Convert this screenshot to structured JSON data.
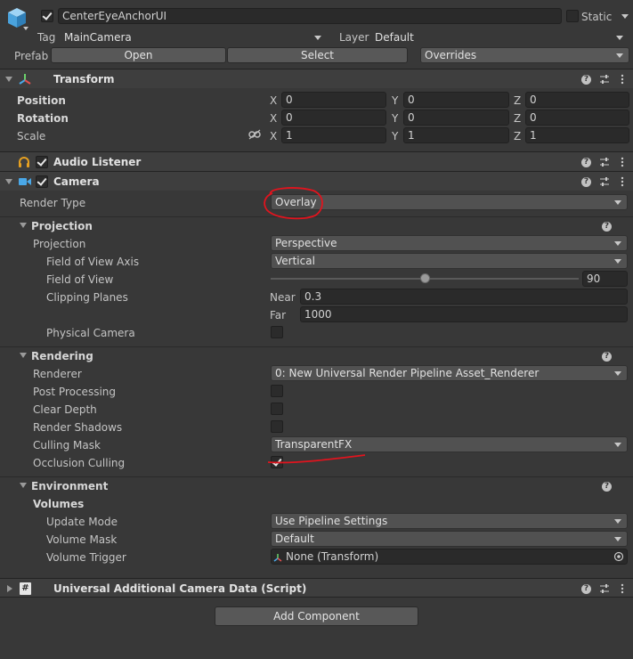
{
  "header": {
    "object_name": "CenterEyeAnchorUI",
    "active": true,
    "static_label": "Static",
    "tag_label": "Tag",
    "tag_value": "MainCamera",
    "layer_label": "Layer",
    "layer_value": "Default",
    "prefab_label": "Prefab",
    "open_label": "Open",
    "select_label": "Select",
    "overrides_label": "Overrides"
  },
  "transform": {
    "title": "Transform",
    "position_label": "Position",
    "rotation_label": "Rotation",
    "scale_label": "Scale",
    "x": "X",
    "y": "Y",
    "z": "Z",
    "position": [
      "0",
      "0",
      "0"
    ],
    "rotation": [
      "0",
      "0",
      "0"
    ],
    "scale": [
      "1",
      "1",
      "1"
    ]
  },
  "audio": {
    "title": "Audio Listener",
    "enabled": true
  },
  "camera": {
    "title": "Camera",
    "enabled": true,
    "render_type_label": "Render Type",
    "render_type_value": "Overlay",
    "projection_section": "Projection",
    "projection_label": "Projection",
    "projection_value": "Perspective",
    "fov_axis_label": "Field of View Axis",
    "fov_axis_value": "Vertical",
    "fov_label": "Field of View",
    "fov_value": "90",
    "fov_level": 0.5,
    "clipping_label": "Clipping Planes",
    "near_label": "Near",
    "near_value": "0.3",
    "far_label": "Far",
    "far_value": "1000",
    "physical_label": "Physical Camera",
    "rendering_section": "Rendering",
    "renderer_label": "Renderer",
    "renderer_value": "0: New Universal Render Pipeline Asset_Renderer",
    "post_processing_label": "Post Processing",
    "clear_depth_label": "Clear Depth",
    "render_shadows_label": "Render Shadows",
    "culling_mask_label": "Culling Mask",
    "culling_mask_value": "TransparentFX",
    "occlusion_label": "Occlusion Culling",
    "environment_section": "Environment",
    "volumes_label": "Volumes",
    "update_mode_label": "Update Mode",
    "update_mode_value": "Use Pipeline Settings",
    "volume_mask_label": "Volume Mask",
    "volume_mask_value": "Default",
    "volume_trigger_label": "Volume Trigger",
    "volume_trigger_value": "None (Transform)"
  },
  "additional": {
    "title": "Universal Additional Camera Data (Script)"
  },
  "add_component_label": "Add Component",
  "colors": {
    "annotation": "#e0141e",
    "camera_icon": "#4aa8e8",
    "audio_icon": "#e6a021"
  }
}
